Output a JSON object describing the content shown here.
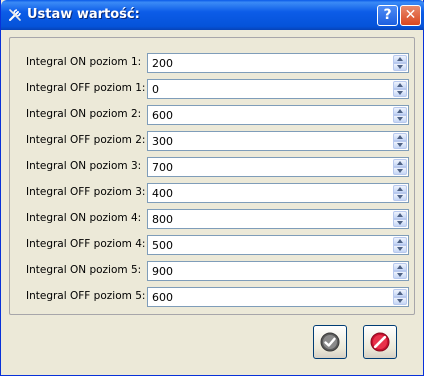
{
  "window": {
    "title": "Ustaw wartość:",
    "help_label": "?",
    "close_label": "✕"
  },
  "fields": [
    {
      "label": "Integral ON poziom 1:",
      "value": "200"
    },
    {
      "label": "Integral OFF poziom 1:",
      "value": "0"
    },
    {
      "label": "Integral ON poziom 2:",
      "value": "600"
    },
    {
      "label": "Integral OFF poziom 2:",
      "value": "300"
    },
    {
      "label": "Integral ON poziom 3:",
      "value": "700"
    },
    {
      "label": "Integral OFF poziom 3:",
      "value": "400"
    },
    {
      "label": "Integral ON poziom 4:",
      "value": "800"
    },
    {
      "label": "Integral OFF poziom 4:",
      "value": "500"
    },
    {
      "label": "Integral ON poziom 5:",
      "value": "900"
    },
    {
      "label": "Integral OFF poziom 5:",
      "value": "600"
    }
  ],
  "icons": {
    "title": "tools-icon",
    "ok": "checkmark-icon",
    "cancel": "no-entry-icon"
  },
  "colors": {
    "titlebar": "#0553d9",
    "dialog_bg": "#ece9d8",
    "close_red": "#d9461f",
    "ok_gray": "#5a5a5a",
    "cancel_red": "#c8102e"
  }
}
